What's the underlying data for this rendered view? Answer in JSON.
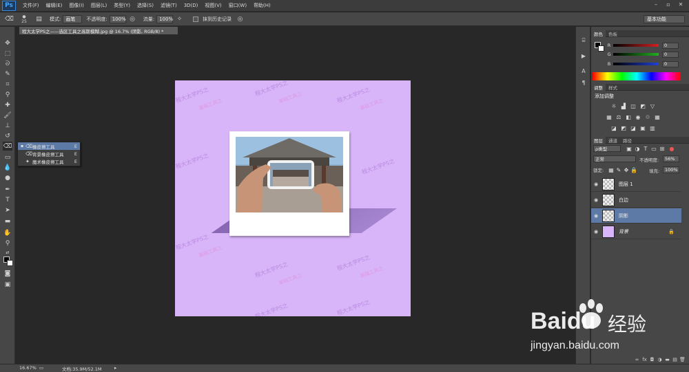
{
  "app": {
    "logo": "Ps"
  },
  "menu": [
    "文件(F)",
    "编辑(E)",
    "图像(I)",
    "图层(L)",
    "类型(Y)",
    "选择(S)",
    "滤镜(T)",
    "3D(D)",
    "视图(V)",
    "窗口(W)",
    "帮助(H)"
  ],
  "options": {
    "brush_size": "25",
    "mode_label": "模式:",
    "mode_value": "画笔",
    "opacity_label": "不透明度:",
    "opacity_value": "100%",
    "flow_label": "流量:",
    "flow_value": "100%",
    "erase_history_label": "抹到历史记录",
    "workspace": "基本功能"
  },
  "document_tab": "程大太学PS之——选区工具之高斯模糊.jpg @ 16.7% (阴影, RGB/8) *",
  "tool_flyout": [
    {
      "label": "橡皮擦工具",
      "key": "E"
    },
    {
      "label": "背景橡皮擦工具",
      "key": "E"
    },
    {
      "label": "魔术橡皮擦工具",
      "key": "E"
    }
  ],
  "canvas": {
    "background": "#d8b4f8",
    "watermark_a": "程大太学PS之",
    "watermark_b": "基础工具之"
  },
  "status": {
    "zoom": "16.67%",
    "doc": "文档:35.9M/52.1M"
  },
  "color_panel": {
    "tabs": [
      "颜色",
      "色板"
    ],
    "channels": [
      {
        "label": "R",
        "value": "0",
        "color": "#d42020"
      },
      {
        "label": "G",
        "value": "0",
        "color": "#20b020"
      },
      {
        "label": "B",
        "value": "0",
        "color": "#2040d8"
      }
    ]
  },
  "adjust_panel": {
    "tabs": [
      "调整",
      "样式"
    ],
    "title": "添加调整"
  },
  "layers_panel": {
    "tabs": [
      "图层",
      "通道",
      "路径"
    ],
    "filter": "ρ类型",
    "blend": "正常",
    "opacity_label": "不透明度:",
    "opacity_value": "56%",
    "lock_label": "锁定:",
    "fill_label": "填充:",
    "fill_value": "100%",
    "layers": [
      {
        "name": "图层 1",
        "selected": false
      },
      {
        "name": "白边",
        "selected": false
      },
      {
        "name": "阴影",
        "selected": true
      },
      {
        "name": "背景",
        "selected": false,
        "locked": true
      }
    ]
  },
  "watermark": {
    "brand": "Baidu",
    "suffix": "经验",
    "url": "jingyan.baidu.com"
  }
}
